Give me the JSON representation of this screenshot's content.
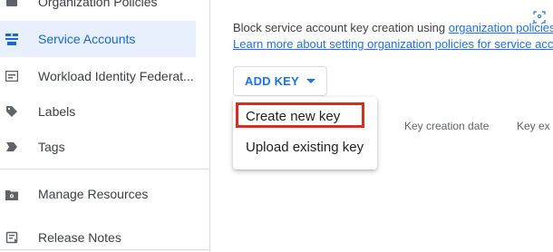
{
  "sidebar": {
    "items": [
      {
        "label": "Organization Policies",
        "icon": "policy-icon",
        "active": false
      },
      {
        "label": "Service Accounts",
        "icon": "service-account-icon",
        "active": true
      },
      {
        "label": "Workload Identity Federat...",
        "icon": "workload-identity-icon",
        "active": false
      },
      {
        "label": "Labels",
        "icon": "label-tag-icon",
        "active": false
      },
      {
        "label": "Tags",
        "icon": "tag-chevron-icon",
        "active": false
      },
      {
        "label": "Manage Resources",
        "icon": "manage-resources-icon",
        "active": false
      },
      {
        "label": "Release Notes",
        "icon": "release-notes-icon",
        "active": false
      }
    ]
  },
  "main": {
    "desc_prefix": "Block service account key creation using ",
    "desc_link1": "organization policies",
    "desc_link2": "Learn more about setting organization policies for service accounts",
    "add_key_label": "ADD KEY",
    "columns": [
      "Key creation date",
      "Key ex"
    ]
  },
  "menu": {
    "items": [
      "Create new key",
      "Upload existing key"
    ],
    "highlighted": "Create new key"
  },
  "colors": {
    "accent": "#1a73e8",
    "active_bg": "#e8f0fe",
    "highlight_border": "#d92d20"
  }
}
